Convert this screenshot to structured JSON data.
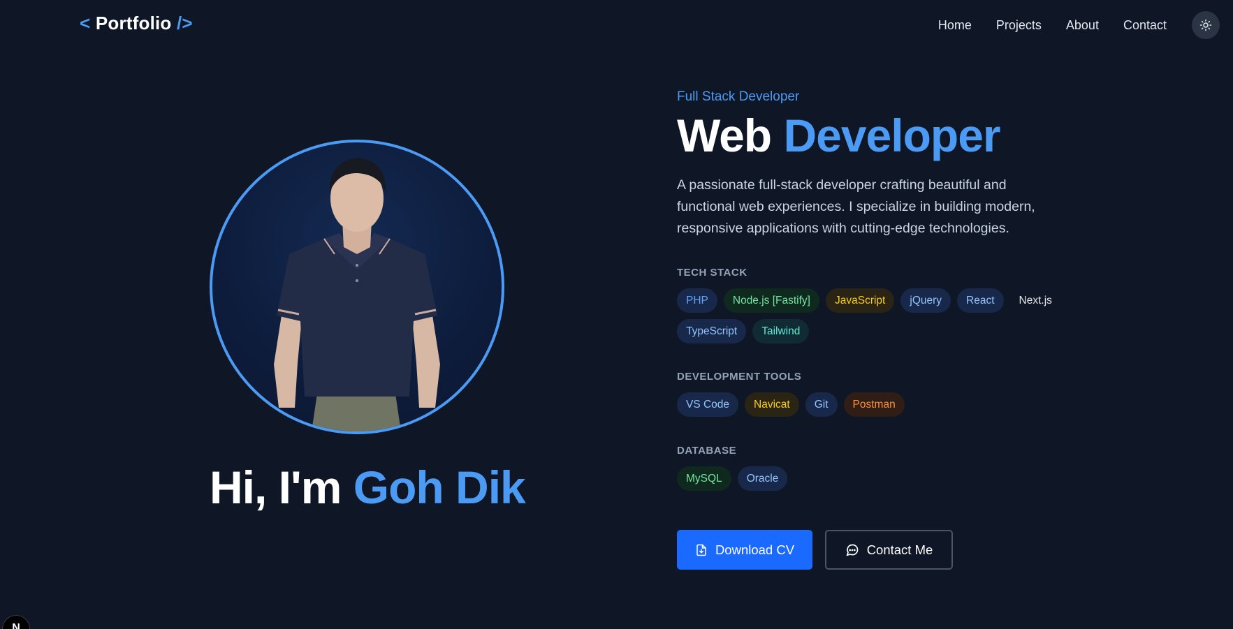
{
  "nav": {
    "logo_open": "<",
    "logo_text": "Portfolio",
    "logo_close": "/>",
    "links": [
      "Home",
      "Projects",
      "About",
      "Contact"
    ],
    "theme_toggle_icon": "sun-icon"
  },
  "hero_left": {
    "greeting": "Hi, I'm",
    "name": "Goh Dik",
    "avatar_icon": "profile-photo",
    "accent_color": "#4b9bf5"
  },
  "hero_right": {
    "role": "Full Stack Developer",
    "headline_plain": "Web",
    "headline_accent": "Developer",
    "description": "A passionate full-stack developer crafting beautiful and functional web experiences. I specialize in building modern, responsive applications with cutting-edge technologies.",
    "tech_stack": {
      "title": "TECH STACK",
      "items": [
        "PHP",
        "Node.js [Fastify]",
        "JavaScript",
        "jQuery",
        "React",
        "Next.js",
        "TypeScript",
        "Tailwind"
      ]
    },
    "dev_tools": {
      "title": "DEVELOPMENT TOOLS",
      "items": [
        "VS Code",
        "Navicat",
        "Git",
        "Postman"
      ]
    },
    "database": {
      "title": "DATABASE",
      "items": [
        "MySQL",
        "Oracle"
      ]
    },
    "buttons": {
      "download_cv": "Download CV",
      "contact_me": "Contact Me"
    }
  },
  "framework_badge": "N",
  "colors": {
    "background": "#0f1626",
    "accent": "#4b9bf5",
    "primary_button": "#1a6aff"
  }
}
